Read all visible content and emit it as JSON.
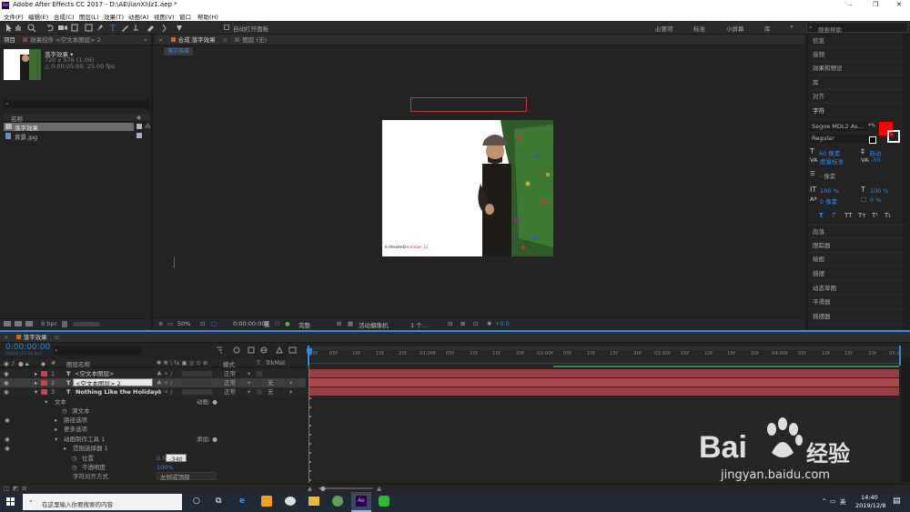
{
  "window": {
    "title": "Adobe After Effects CC 2017 - D:\\AE\\lianXi\\lz1.aep *",
    "minimize": "–",
    "maximize": "❐",
    "close": "✕"
  },
  "menu": [
    "文件(F)",
    "编辑(E)",
    "合成(C)",
    "图层(L)",
    "效果(T)",
    "动画(A)",
    "视图(V)",
    "窗口",
    "帮助(H)"
  ],
  "toolbar": {
    "auto_open": "自动打开面板",
    "workspaces": [
      "必要项",
      "标准",
      "小屏幕",
      "库"
    ],
    "search_placeholder": "搜索帮助"
  },
  "project": {
    "tabs": [
      "项目",
      "效果控件 <空文本图层> 2"
    ],
    "thumb_name": "落字效果 ▾",
    "thumb_info1": "720 x 576 (1.09)",
    "thumb_info2": "△ 0:00:05:00, 25.00 fps",
    "col_name": "名称",
    "items": [
      {
        "name": "落字效果"
      },
      {
        "name": "背景.jpg"
      }
    ],
    "bpc": "8 bpc"
  },
  "composition": {
    "tabs": [
      "合成 落字效果",
      "图层 (无)"
    ],
    "sub_tab": "落字效果",
    "poster_text": "In theaters",
    "poster_date": "December 12",
    "zoom": "50%",
    "time": "0:00:00:00",
    "quality": "完整",
    "camera": "活动摄像机",
    "views": "1 个...",
    "exposure": "+0.0"
  },
  "right_panel": {
    "items_top": [
      "信息",
      "音频",
      "效果和预设",
      "库",
      "对齐"
    ],
    "char_title": "字符",
    "font": "Segoe MDL2 As...",
    "style": "Regular",
    "size": "60 像素",
    "leading": "自动",
    "kerning": "度量标准",
    "tracking": "-50",
    "stroke": "- 像素",
    "scale_v": "100 %",
    "scale_h": "100 %",
    "baseline": "0 像素",
    "tsume": "0 %",
    "type_buttons": [
      "T",
      "T",
      "TT",
      "Tт",
      "T¹",
      "T₁"
    ],
    "items_bottom": [
      "段落",
      "跟踪器",
      "绘画",
      "摇摆",
      "动态草图",
      "平滑器",
      "摇摆器"
    ],
    "colors": {
      "fill": "#ff0000",
      "stroke": "#ffffff"
    }
  },
  "timeline": {
    "tab": "落字效果",
    "timecode": "0:00:00:00",
    "timecode_sub": "00000 (25.00 fps)",
    "headers": {
      "name": "图层名称",
      "mode": "模式",
      "trkmat": "TrkMat",
      "t": "T"
    },
    "layers": [
      {
        "num": "1",
        "name": "<空文本图层>",
        "mode": "正常",
        "trk": ""
      },
      {
        "num": "2",
        "name": "<空文本图层> 2",
        "mode": "正常",
        "trk": "无"
      },
      {
        "num": "3",
        "name": "Nothing Like the Holidays",
        "mode": "正常",
        "trk": "无"
      }
    ],
    "props": [
      {
        "label": "文本",
        "extra": "动画: ●"
      },
      {
        "label": "源文本",
        "extra": ""
      },
      {
        "label": "路径选项",
        "extra": ""
      },
      {
        "label": "更多选项",
        "extra": ""
      },
      {
        "label": "动画制作工具 1",
        "extra": "添加: ●"
      },
      {
        "label": "范围选择器 1",
        "extra": ""
      },
      {
        "label": "位置",
        "extra": ""
      },
      {
        "label": "不透明度",
        "extra": ""
      },
      {
        "label": "字符对齐方式",
        "extra": ""
      }
    ],
    "pos_x": "0.0",
    "pos_y": "-340",
    "opacity": "100%",
    "align": "左侧或顶部",
    "ruler": [
      "00f",
      "05f",
      "10f",
      "15f",
      "20f",
      "01:00f",
      "05f",
      "10f",
      "15f",
      "20f",
      "02:00f",
      "05f",
      "10f",
      "15f",
      "20f",
      "03:00f",
      "05f",
      "10f",
      "15f",
      "20f",
      "04:00f",
      "05f",
      "10f",
      "15f",
      "20f",
      "05:0"
    ]
  },
  "taskbar": {
    "search_placeholder": "在这里输入你要搜索的内容",
    "time": "14:40",
    "date": "2019/12/8",
    "ime": "英"
  },
  "watermark": {
    "brand": "Bai",
    "brand2": "经验",
    "url": "jingyan.baidu.com"
  }
}
